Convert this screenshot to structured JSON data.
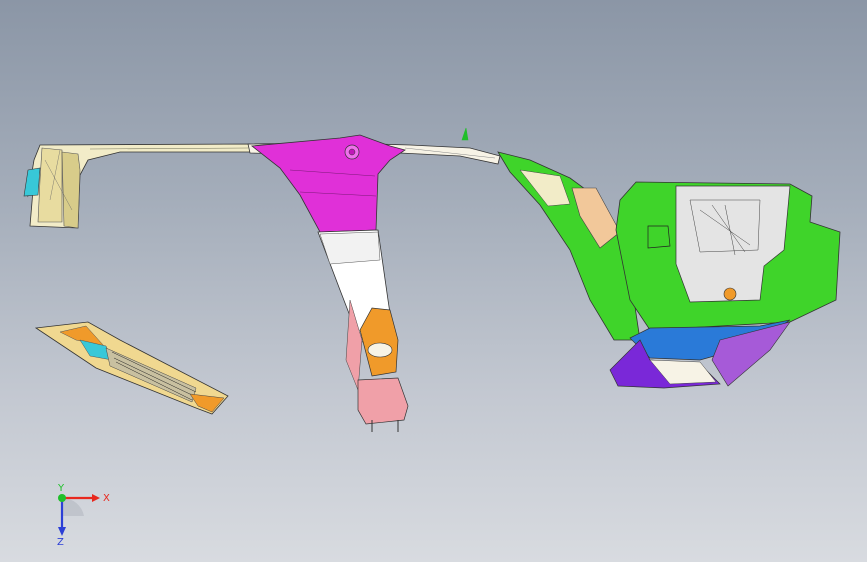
{
  "viewport": {
    "background_top": "#8b96a6",
    "background_bottom": "#d8dbe0"
  },
  "triad": {
    "x_label": "X",
    "y_label": "Y",
    "z_label": "Z",
    "x_color": "#e8281e",
    "y_color": "#1fbf2a",
    "z_color": "#2b3fd6"
  },
  "model_marker_label": "Y",
  "parts": {
    "fender_front": "front-fender-part",
    "cowl_panel": "cowl-panel-part",
    "b_pillar": "b-pillar-part",
    "roof_rail": "roof-rail-part",
    "rear_quarter": "rear-quarter-panel-part"
  },
  "colors": {
    "magenta": "#e030d8",
    "green": "#3fd42a",
    "cream": "#f2ecc8",
    "orange": "#f09a2a",
    "cyan": "#38c8d8",
    "purple": "#7a28d8",
    "blue": "#2a7ad8",
    "pink": "#f0a0a8"
  }
}
